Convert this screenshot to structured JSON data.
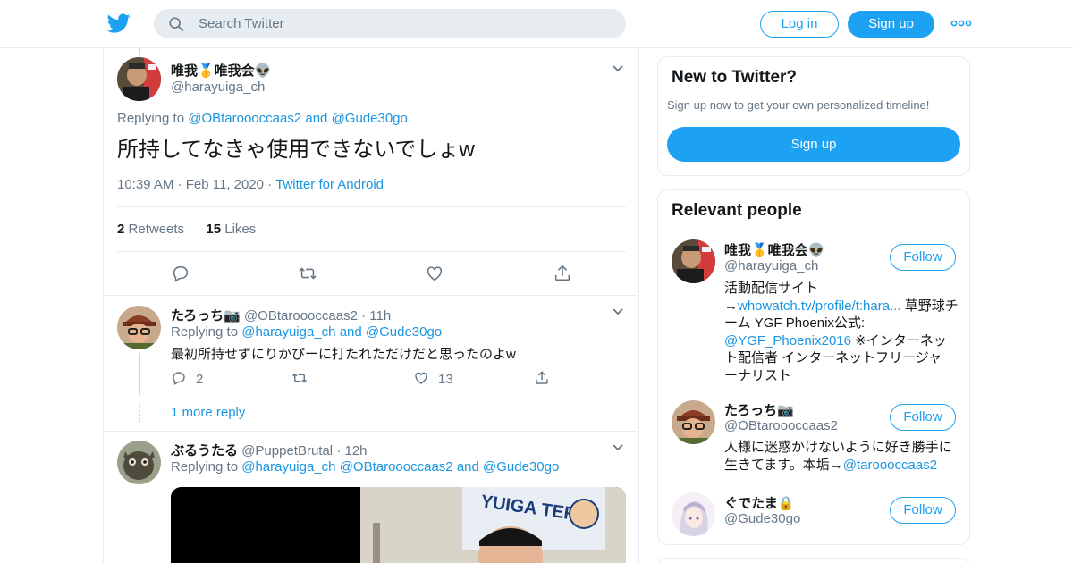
{
  "header": {
    "search_placeholder": "Search Twitter",
    "login_label": "Log in",
    "signup_label": "Sign up"
  },
  "main_tweet": {
    "display_name": "唯我🥇唯我会👽",
    "handle": "@harayuiga_ch",
    "replying_prefix": "Replying to",
    "replying_to_1": "@OBtaroooccaas2",
    "replying_and": "and",
    "replying_to_2": "@Gude30go",
    "text": "所持してなきゃ使用できないでしょw",
    "time": "10:39 AM",
    "date": "Feb 11, 2020",
    "source": "Twitter for Android",
    "retweets_count": "2",
    "retweets_label": "Retweets",
    "likes_count": "15",
    "likes_label": "Likes"
  },
  "replies": [
    {
      "display_name": "たろっち📷",
      "handle": "@OBtaroooccaas2",
      "time": "11h",
      "replying_prefix": "Replying to",
      "replying_to_1": "@harayuiga_ch",
      "replying_and": "and",
      "replying_to_2": "@Gude30go",
      "text": "最初所持せずにりかぴーに打たれただけだと思ったのよw",
      "reply_count": "2",
      "like_count": "13",
      "more_replies": "1 more reply"
    },
    {
      "display_name": "ぶるうたる",
      "handle": "@PuppetBrutal",
      "time": "12h",
      "replying_prefix": "Replying to",
      "replying_to_1": "@harayuiga_ch",
      "replying_to_2": "@OBtaroooccaas2",
      "replying_and": "and",
      "replying_to_3": "@Gude30go",
      "media_text": "YUIGA TER"
    }
  ],
  "new_to_twitter": {
    "title": "New to Twitter?",
    "subtitle": "Sign up now to get your own personalized timeline!",
    "signup_label": "Sign up"
  },
  "relevant_people": {
    "title": "Relevant people",
    "follow_label": "Follow",
    "people": [
      {
        "display_name": "唯我🥇唯我会👽",
        "handle": "@harayuiga_ch",
        "bio_1": "活動配信サイト",
        "bio_2_prefix": "→",
        "bio_2_link": "whowatch.tv/profile/t:hara...",
        "bio_2_suffix": " 草野球チ",
        "bio_3": "ーム YGF Phoenix公式:",
        "bio_4_link": "@YGF_Phoenix2016",
        "bio_4_suffix": " ※インターネッ",
        "bio_5": "ト配信者 インターネットフリージャ",
        "bio_6": "ーナリスト"
      },
      {
        "display_name": "たろっち📷",
        "handle": "@OBtaroooccaas2",
        "bio_1": "人様に迷惑かけないように好き勝手に",
        "bio_2_prefix": "生きてます。本垢→",
        "bio_2_link": "@taroooccaas2"
      },
      {
        "display_name": "ぐでたま🔒",
        "handle": "@Gude30go"
      }
    ]
  },
  "colors": {
    "brand": "#1da1f2",
    "link": "#1b95e0",
    "text": "#14171a",
    "muted": "#657786",
    "border": "#e6ecf0"
  }
}
